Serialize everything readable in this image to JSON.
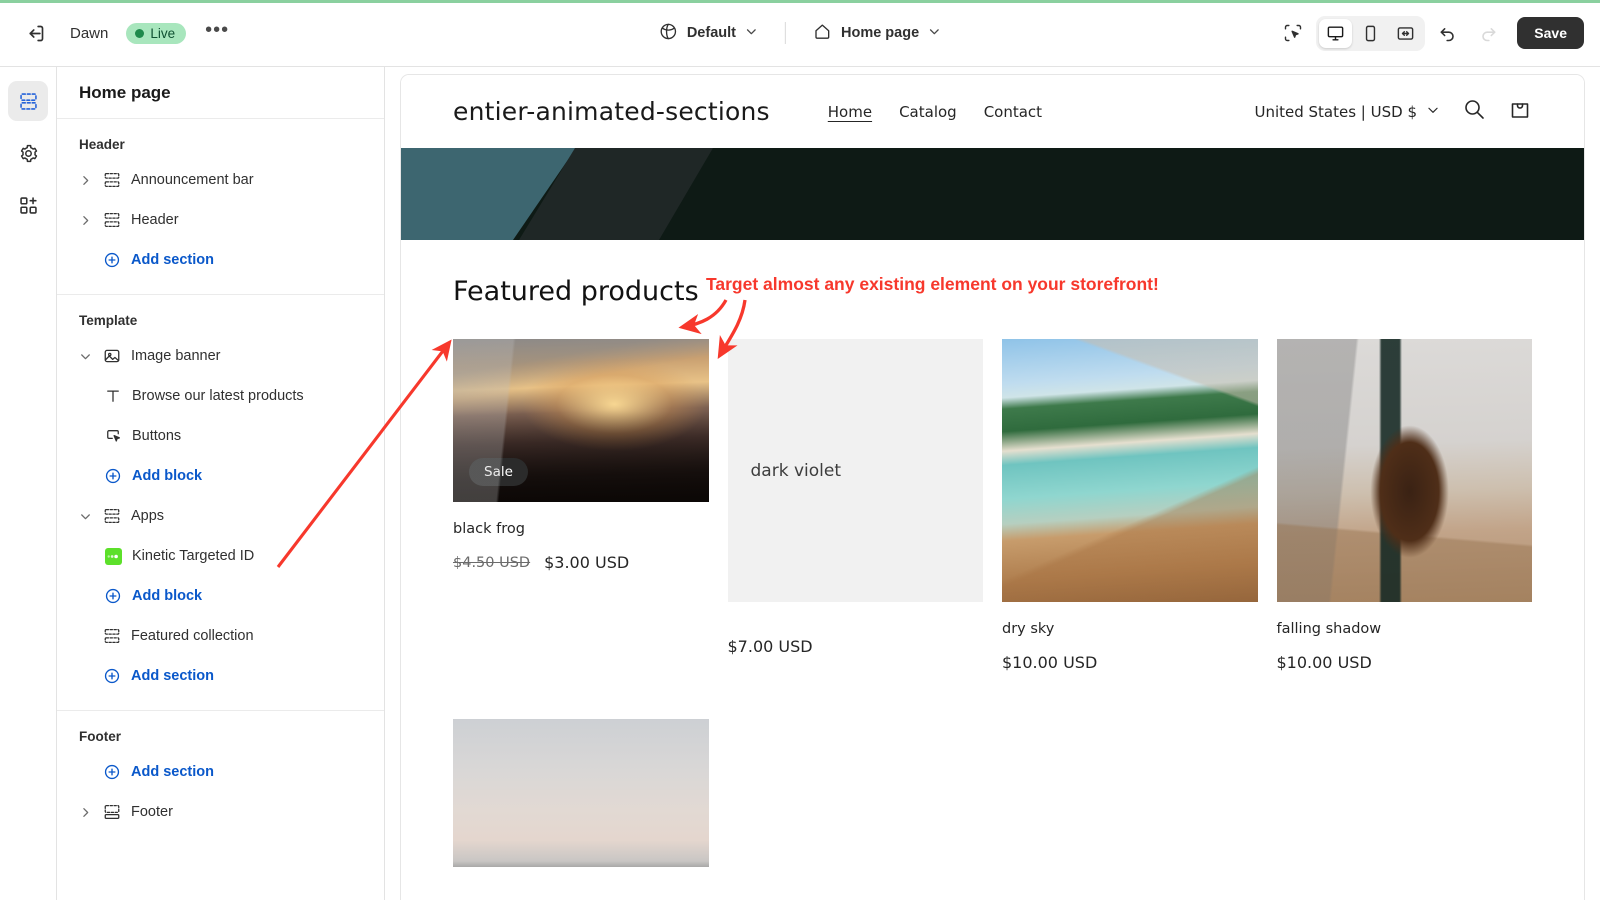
{
  "topbar": {
    "exit_icon": "exit-icon",
    "theme_name": "Dawn",
    "status_badge": "Live",
    "more_label": "•••",
    "theme_selector": {
      "icon": "globe-icon",
      "label": "Default",
      "caret": "chevron-down-icon"
    },
    "page_selector": {
      "icon": "home-icon",
      "label": "Home page",
      "caret": "chevron-down-icon"
    },
    "inspector_icon": "inspect-select-icon",
    "devices": [
      {
        "name": "desktop",
        "icon": "desktop-icon",
        "active": true
      },
      {
        "name": "mobile",
        "icon": "mobile-icon",
        "active": false
      },
      {
        "name": "fullscreen",
        "icon": "fullwidth-icon",
        "active": false
      }
    ],
    "undo_icon": "undo-icon",
    "redo_icon": "redo-icon",
    "redo_disabled": true,
    "save_label": "Save"
  },
  "rail": {
    "items": [
      {
        "name": "sections",
        "icon": "sections-icon",
        "active": true
      },
      {
        "name": "settings",
        "icon": "gear-icon",
        "active": false
      },
      {
        "name": "apps",
        "icon": "apps-add-icon",
        "active": false
      }
    ]
  },
  "sidebar": {
    "title": "Home page",
    "groups": [
      {
        "label": "Header",
        "rows": [
          {
            "caret": "chevron-right",
            "icon": "section-icon",
            "label": "Announcement bar",
            "indent": 0,
            "link": false
          },
          {
            "caret": "chevron-right",
            "icon": "section-icon",
            "label": "Header",
            "indent": 0,
            "link": false
          },
          {
            "caret": "none",
            "icon": "plus-circle-icon",
            "label": "Add section",
            "indent": 0,
            "link": true
          }
        ]
      },
      {
        "label": "Template",
        "rows": [
          {
            "caret": "chevron-down",
            "icon": "image-banner-icon",
            "label": "Image banner",
            "indent": 0,
            "link": false
          },
          {
            "caret": "none",
            "icon": "text-block-icon",
            "label": "Browse our latest products",
            "indent": 1,
            "link": false
          },
          {
            "caret": "none",
            "icon": "buttons-icon",
            "label": "Buttons",
            "indent": 1,
            "link": false
          },
          {
            "caret": "none",
            "icon": "plus-circle-icon",
            "label": "Add block",
            "indent": 1,
            "link": true
          },
          {
            "caret": "chevron-down",
            "icon": "section-icon",
            "label": "Apps",
            "indent": 0,
            "link": false
          },
          {
            "caret": "none",
            "icon": "kinetic-app-icon",
            "label": "Kinetic Targeted ID",
            "indent": 1,
            "link": false
          },
          {
            "caret": "none",
            "icon": "plus-circle-icon",
            "label": "Add block",
            "indent": 1,
            "link": true
          },
          {
            "caret": "none",
            "icon": "section-icon",
            "label": "Featured collection",
            "indent": 0,
            "link": false
          },
          {
            "caret": "none",
            "icon": "plus-circle-icon",
            "label": "Add section",
            "indent": 0,
            "link": true
          }
        ]
      },
      {
        "label": "Footer",
        "rows": [
          {
            "caret": "none",
            "icon": "plus-circle-icon",
            "label": "Add section",
            "indent": 0,
            "link": true
          },
          {
            "caret": "chevron-right",
            "icon": "footer-icon",
            "label": "Footer",
            "indent": 0,
            "link": false
          }
        ]
      }
    ]
  },
  "preview": {
    "store_name": "entier-animated-sections",
    "nav": [
      {
        "label": "Home",
        "active": true
      },
      {
        "label": "Catalog",
        "active": false
      },
      {
        "label": "Contact",
        "active": false
      }
    ],
    "locale": "United States | USD $",
    "locale_caret": "chevron-down-icon",
    "search_icon": "search-icon",
    "cart_icon": "cart-icon",
    "banner_colors": [
      "#3d6670",
      "#1f2726",
      "#0e1a15"
    ],
    "featured_title": "Featured products",
    "products": [
      {
        "title": "black frog",
        "badge": "Sale",
        "price_old": "$4.50 USD",
        "price": "$3.00 USD",
        "media": "photo-canyon",
        "media_height": 163,
        "placeholder_text": ""
      },
      {
        "title": "",
        "badge": "",
        "price_old": "",
        "price": "$7.00 USD",
        "media": "placeholder",
        "media_height": 263,
        "placeholder_text": "dark violet"
      },
      {
        "title": "dry sky",
        "badge": "",
        "price_old": "",
        "price": "$10.00 USD",
        "media": "photo-beach",
        "media_height": 263,
        "placeholder_text": ""
      },
      {
        "title": "falling shadow",
        "badge": "",
        "price_old": "",
        "price": "$10.00 USD",
        "media": "photo-coffee",
        "media_height": 263,
        "placeholder_text": ""
      }
    ],
    "next_row_products": [
      {
        "media": "photo-sky",
        "media_height": 148
      }
    ]
  },
  "annotation": {
    "text": "Target almost any existing element on your storefront!",
    "color": "#f7382c"
  }
}
